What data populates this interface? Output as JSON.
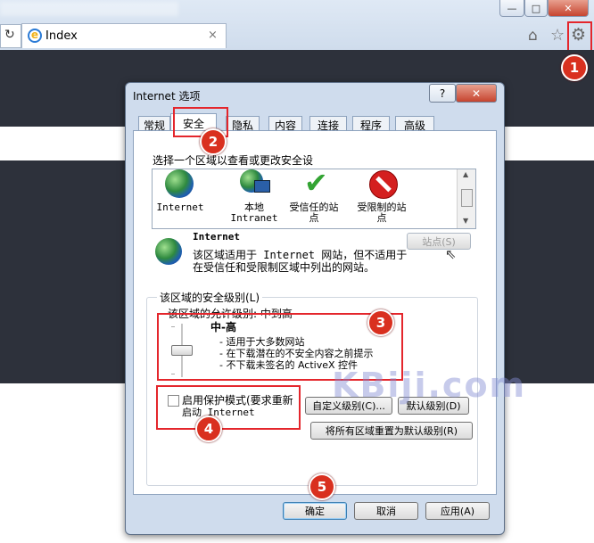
{
  "browser": {
    "blurred_title": "...",
    "tab_title": "Index",
    "window_buttons": [
      "—",
      "□",
      "✕"
    ],
    "toolbar_icons": [
      "home-icon",
      "star-icon",
      "gear-icon"
    ]
  },
  "callouts": [
    "1",
    "2",
    "3",
    "4",
    "5"
  ],
  "dialog": {
    "title": "Internet 选项",
    "help": "?",
    "close": "✕",
    "tabs": [
      "常规",
      "安全",
      "隐私",
      "内容",
      "连接",
      "程序",
      "高级"
    ],
    "active_tab": "安全",
    "zone_prompt": "选择一个区域以查看或更改安全设",
    "zones": [
      {
        "line1": "Internet",
        "line2": ""
      },
      {
        "line1": "本地",
        "line2": "Intranet"
      },
      {
        "line1": "受信任的站",
        "line2": "点"
      },
      {
        "line1": "受限制的站",
        "line2": "点"
      }
    ],
    "selected_zone": {
      "name": "Internet",
      "desc_line1": "该区域适用于 Internet 网站，但不适用于",
      "desc_line2": "在受信任和受限制区域中列出的网站。",
      "sites_button": "站点(S)"
    },
    "security_group_label": "该区域的安全级别(L)",
    "allowed_levels": "该区域的允许级别: 中到高",
    "level": {
      "name": "中-高",
      "bullets": [
        "- 适用于大多数网站",
        "- 在下载潜在的不安全内容之前提示",
        "- 不下载未签名的 ActiveX 控件"
      ]
    },
    "protected_mode": {
      "line1": "启用保护模式(要求重新",
      "line2": "启动 Internet",
      "checked": false
    },
    "custom_level_button": "自定义级别(C)...",
    "default_level_button": "默认级别(D)",
    "reset_all_button": "将所有区域重置为默认级别(R)",
    "ok_button": "确定",
    "cancel_button": "取消",
    "apply_button": "应用(A)"
  },
  "watermark": "KBiji.com"
}
